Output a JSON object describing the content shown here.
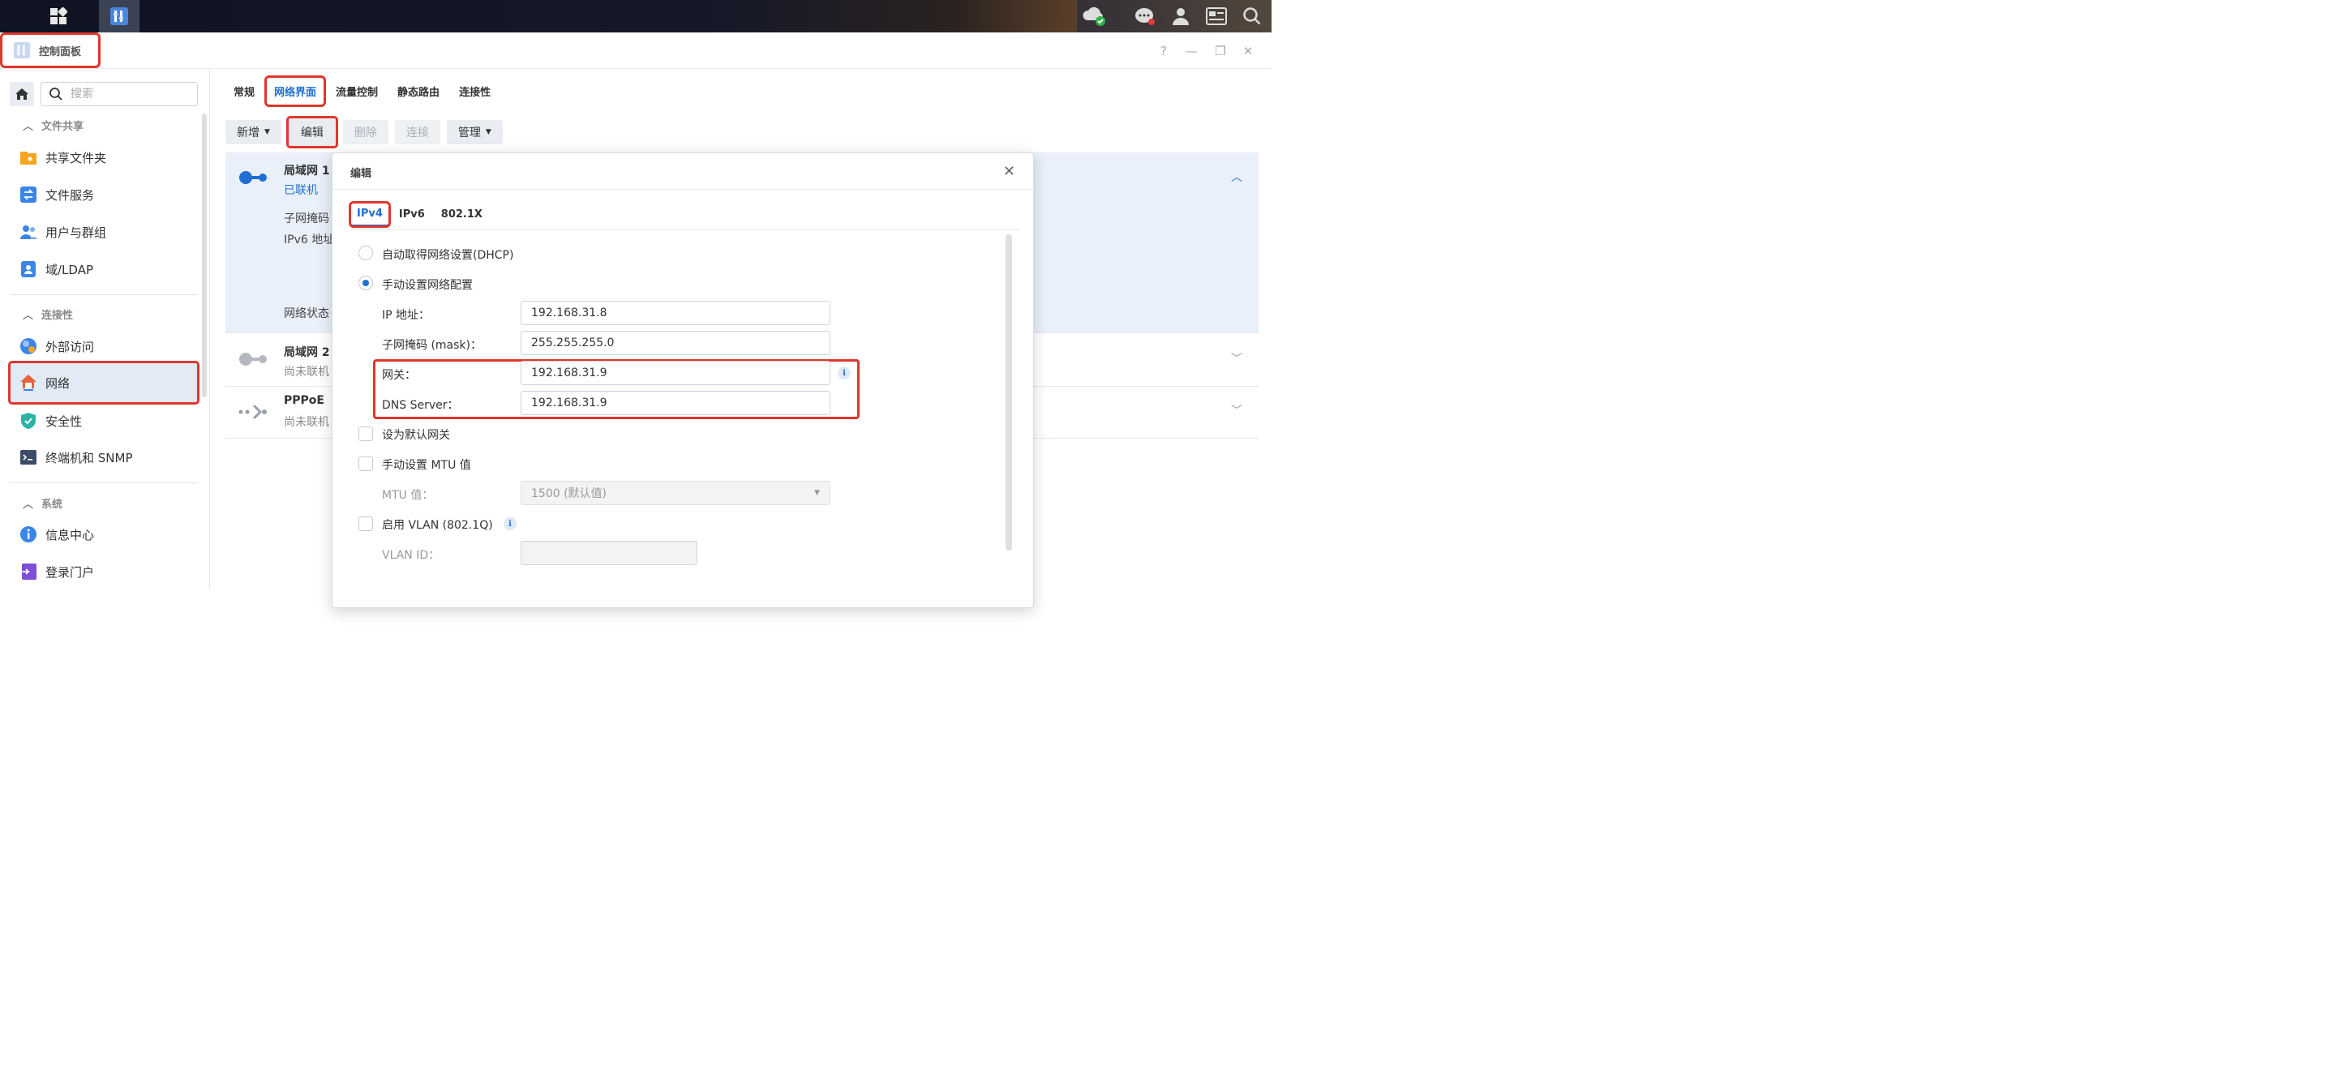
{
  "app": {
    "title": "控制面板"
  },
  "sidebar": {
    "search_placeholder": "搜索",
    "sections": [
      {
        "title": "文件共享",
        "items": [
          "共享文件夹",
          "文件服务",
          "用户与群组",
          "域/LDAP"
        ]
      },
      {
        "title": "连接性",
        "items": [
          "外部访问",
          "网络",
          "安全性",
          "终端机和 SNMP"
        ]
      },
      {
        "title": "系统",
        "items": [
          "信息中心",
          "登录门户"
        ]
      }
    ],
    "active_item": "网络"
  },
  "main": {
    "tabs": [
      "常规",
      "网络界面",
      "流量控制",
      "静态路由",
      "连接性"
    ],
    "active_tab": "网络界面",
    "toolbar": {
      "add": "新增",
      "edit": "编辑",
      "delete": "删除",
      "connect": "连接",
      "manage": "管理"
    },
    "interfaces": [
      {
        "name": "局域网 1",
        "status": "已联机",
        "details": [
          "子网掩码",
          "IPv6 地址",
          "网络状态"
        ]
      },
      {
        "name": "局域网 2",
        "status": "尚未联机"
      },
      {
        "name": "PPPoE",
        "status": "尚未联机"
      }
    ]
  },
  "dialog": {
    "title": "编辑",
    "tabs": [
      "IPv4",
      "IPv6",
      "802.1X"
    ],
    "active_tab": "IPv4",
    "options": {
      "dhcp": "自动取得网络设置(DHCP)",
      "manual": "手动设置网络配置"
    },
    "fields": {
      "ip_label": "IP 地址：",
      "ip_value": "192.168.31.8",
      "mask_label": "子网掩码 (mask)：",
      "mask_value": "255.255.255.0",
      "gateway_label": "网关：",
      "gateway_value": "192.168.31.9",
      "dns_label": "DNS Server：",
      "dns_value": "192.168.31.9"
    },
    "default_gateway": "设为默认网关",
    "mtu_manual": "手动设置 MTU 值",
    "mtu_label": "MTU 值：",
    "mtu_value": "1500 (默认值)",
    "vlan_enable": "启用 VLAN (802.1Q)",
    "vlan_id_label": "VLAN ID："
  },
  "colors": {
    "accent": "#1f6fd1",
    "highlight": "#e0362c"
  }
}
